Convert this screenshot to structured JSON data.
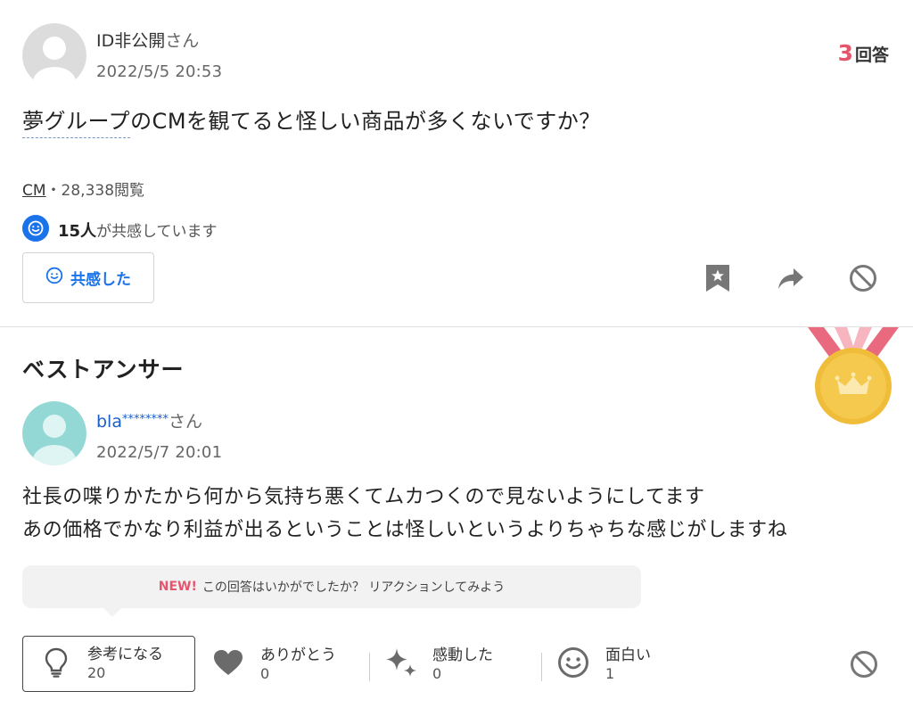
{
  "question": {
    "user": {
      "name": "ID非公開",
      "suffix": "さん",
      "date": "2022/5/5 20:53"
    },
    "answer_count": {
      "num": "3",
      "label": "回答"
    },
    "text_underlined": "夢グループ",
    "text_rest": "のCMを観てると怪しい商品が多くないですか？",
    "tag": "CM",
    "views": "・28,338閲覧",
    "empathy": {
      "count": "15人",
      "text": "が共感しています"
    },
    "empathy_button": "共感した",
    "actions": {
      "bookmark": "bookmark-icon",
      "share": "share-icon",
      "block": "block-icon"
    }
  },
  "best_answer": {
    "title": "ベストアンサー",
    "user": {
      "name": "bla",
      "masked": "********",
      "suffix": "さん",
      "date": "2022/5/7 20:01"
    },
    "lines": [
      "社長の喋りかたから何から気持ち悪くてムカつくので見ないようにしてます",
      "あの価格でかなり利益が出るということは怪しいというよりちゃちな感じがしますね"
    ],
    "prompt": {
      "new": "NEW!",
      "text": "この回答はいかがでしたか？ リアクションしてみよう"
    },
    "reactions": [
      {
        "label": "参考になる",
        "count": "20",
        "icon": "lightbulb-icon"
      },
      {
        "label": "ありがとう",
        "count": "0",
        "icon": "heart-icon"
      },
      {
        "label": "感動した",
        "count": "0",
        "icon": "sparkle-icon"
      },
      {
        "label": "面白い",
        "count": "1",
        "icon": "smile-icon"
      }
    ]
  },
  "colors": {
    "accent_red": "#e5566e",
    "link_blue": "#1a5fc8",
    "empathy_blue": "#1a73e8",
    "medal_gold": "#f2c23c",
    "ribbon_red": "#e96a7e"
  }
}
